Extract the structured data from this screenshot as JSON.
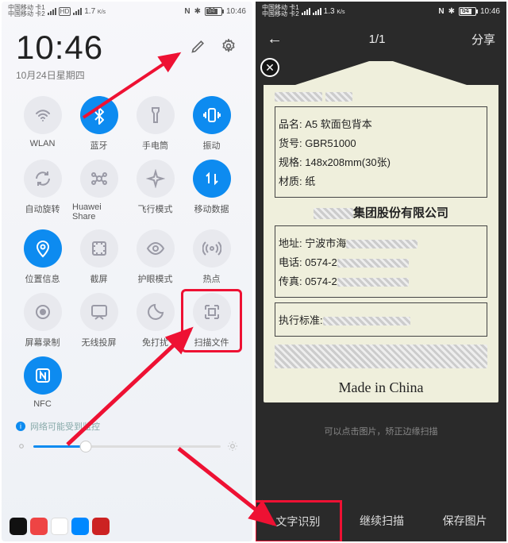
{
  "statusbar": {
    "carrier_lines": [
      "中国移动 卡1",
      "中国移动 卡2"
    ],
    "net_badge": "HD",
    "speed": "1.7",
    "speed_unit": "K/s",
    "speed_right": "1.3",
    "nfc": "N",
    "bt": "✱",
    "batt": "64",
    "time": "10:46"
  },
  "quicksettings": {
    "time": "10:46",
    "date": "10月24日星期四",
    "tiles": [
      {
        "label": "WLAN",
        "icon": "wifi",
        "on": false
      },
      {
        "label": "蓝牙",
        "icon": "bluetooth",
        "on": true
      },
      {
        "label": "手电筒",
        "icon": "flashlight",
        "on": false
      },
      {
        "label": "振动",
        "icon": "vibrate",
        "on": true
      },
      {
        "label": "自动旋转",
        "icon": "rotate",
        "on": false
      },
      {
        "label": "Huawei Share",
        "icon": "hshare",
        "on": false
      },
      {
        "label": "飞行模式",
        "icon": "airplane",
        "on": false
      },
      {
        "label": "移动数据",
        "icon": "data",
        "on": true
      },
      {
        "label": "位置信息",
        "icon": "location",
        "on": true
      },
      {
        "label": "截屏",
        "icon": "screenshot",
        "on": false
      },
      {
        "label": "护眼模式",
        "icon": "eye",
        "on": false
      },
      {
        "label": "热点",
        "icon": "hotspot",
        "on": false
      },
      {
        "label": "屏幕录制",
        "icon": "record",
        "on": false
      },
      {
        "label": "无线投屏",
        "icon": "cast",
        "on": false
      },
      {
        "label": "免打扰",
        "icon": "dnd",
        "on": false
      },
      {
        "label": "扫描文件",
        "icon": "scan",
        "on": false
      },
      {
        "label": "NFC",
        "icon": "nfc",
        "on": true
      }
    ],
    "notice": "网络可能受到监控"
  },
  "scanner": {
    "counter": "1/1",
    "share": "分享",
    "doc": {
      "l1_key": "品名:",
      "l1_val": "A5 软面包背本",
      "l2_key": "货号:",
      "l2_val": "GBR51000",
      "l3_key": "规格:",
      "l3_val": "148x208mm(30张)",
      "l4_key": "材质:",
      "l4_val": "纸",
      "company_suffix": "集团股份有限公司",
      "addr_key": "地址:",
      "addr_val": "宁波市海",
      "tel_key": "电话:",
      "tel_val": "0574-2",
      "fax_key": "传真:",
      "fax_val": "0574-2",
      "std_key": "执行标准:",
      "origin": "Made in China"
    },
    "tip": "可以点击图片，矫正边缘扫描",
    "actions": [
      "文字识别",
      "继续扫描",
      "保存图片"
    ]
  }
}
